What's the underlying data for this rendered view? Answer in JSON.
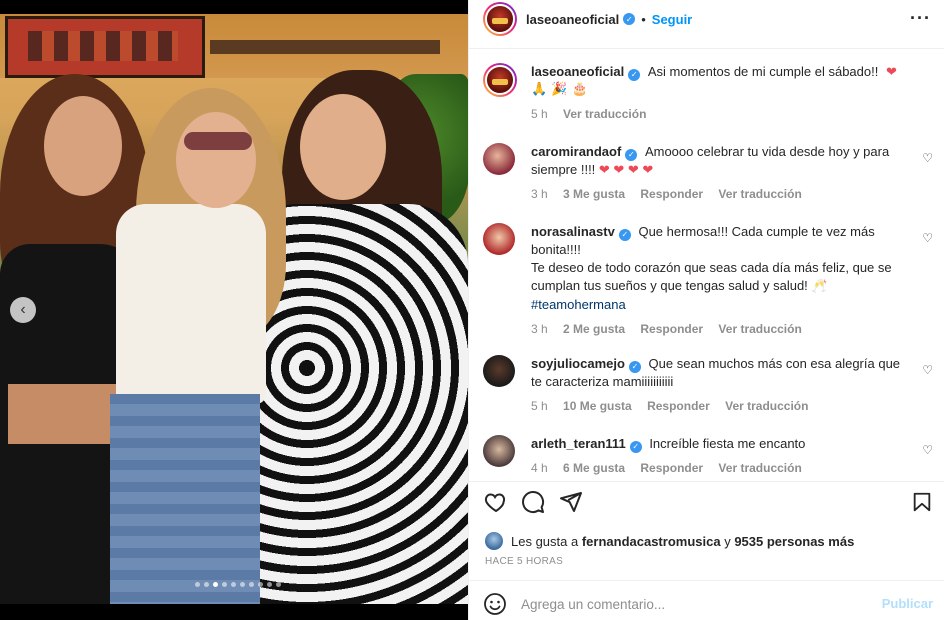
{
  "post": {
    "author": "laseoaneoficial",
    "follow_label": "Seguir",
    "separator": "•",
    "more_icon": "more-horizontal-icon"
  },
  "caption": {
    "username": "laseoaneoficial",
    "text": "Asi momentos de mi cumple el sábado!!",
    "emoji_line1": "❤",
    "emoji_line2": "🙏 🎉 🎂",
    "time": "5 h",
    "translate": "Ver traducción"
  },
  "comments": [
    {
      "username": "caromirandaof",
      "text": "Amoooo celebrar tu vida desde hoy y para siempre !!!!",
      "emojis": "❤ ❤ ❤ ❤",
      "time": "3 h",
      "likes": "3 Me gusta",
      "reply": "Responder",
      "translate": "Ver traducción"
    },
    {
      "username": "norasalinastv",
      "text": "Que hermosa!!! Cada cumple te vez más bonita!!!!",
      "text2": "Te deseo de todo corazón que seas cada día más feliz, que se cumplan tus sueños y que tengas salud y salud!",
      "emojis": "🥂",
      "hashtag": "#teamohermana",
      "time": "3 h",
      "likes": "2 Me gusta",
      "reply": "Responder",
      "translate": "Ver traducción"
    },
    {
      "username": "soyjuliocamejo",
      "text": "Que sean muchos más con esa alegría que te caracteriza mamiiiiiiiiiii",
      "time": "5 h",
      "likes": "10 Me gusta",
      "reply": "Responder",
      "translate": "Ver traducción"
    },
    {
      "username": "arleth_teran111",
      "text": "Increíble fiesta me encanto",
      "time": "4 h",
      "likes": "6 Me gusta",
      "reply": "Responder",
      "translate": "Ver traducción"
    }
  ],
  "likes": {
    "prefix": "Les gusta a",
    "user": "fernandacastromusica",
    "connector": "y",
    "others": "9535 personas más"
  },
  "timestamp": "HACE 5 HORAS",
  "add_comment": {
    "placeholder": "Agrega un comentario...",
    "publish": "Publicar"
  },
  "carousel": {
    "dot_count": 10,
    "active_index": 2
  },
  "colors": {
    "link_blue": "#0095f6",
    "verified_blue": "#3897f0",
    "heart_red": "#ed4956",
    "muted": "#8e8e8e",
    "publish_disabled": "#b2dffc"
  }
}
